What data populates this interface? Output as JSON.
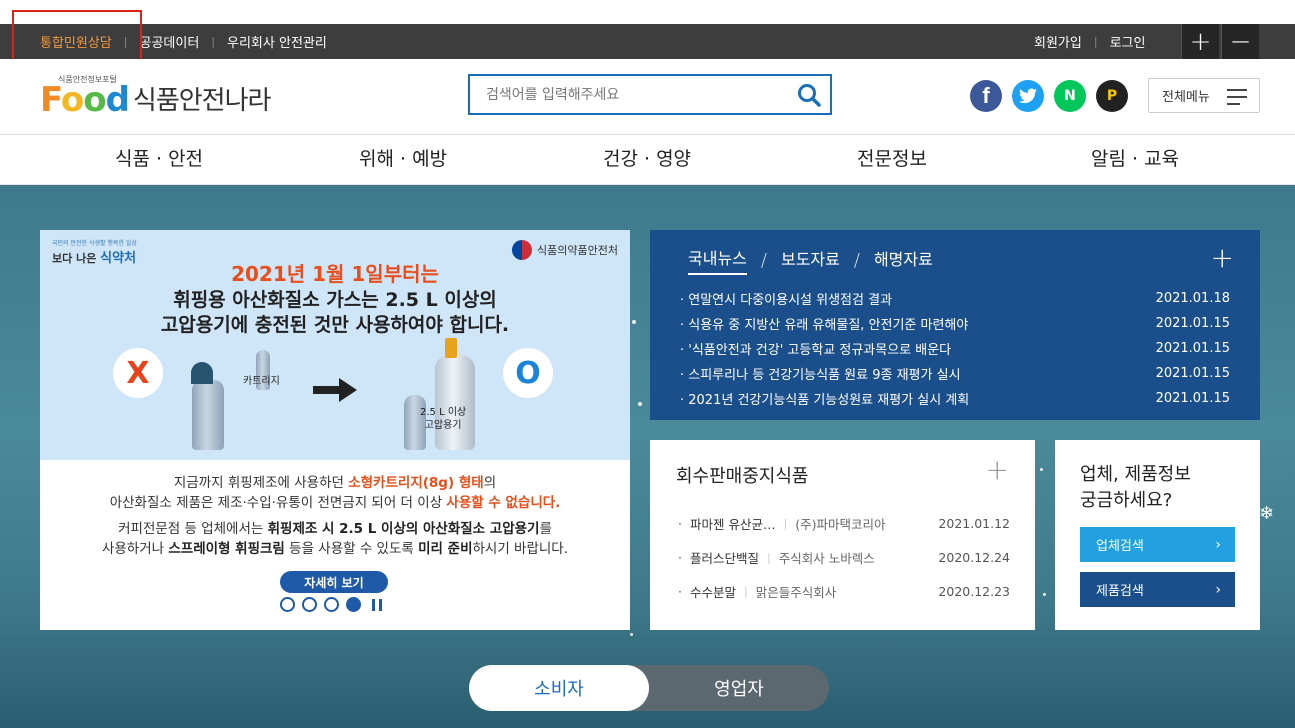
{
  "topbar": {
    "links": [
      "통합민원상담",
      "공공데이터",
      "우리회사 안전관리"
    ],
    "join": "회원가입",
    "login": "로그인",
    "zoom_in": "+",
    "zoom_out": "−"
  },
  "header": {
    "logo_sub": "식품안전정보포털",
    "logo_food": [
      "F",
      "o",
      "o",
      "d"
    ],
    "logo_title": "식품안전나라",
    "search_placeholder": "검색어를 입력해주세요",
    "social": {
      "facebook": "f",
      "naver": "N",
      "kakao": "P"
    },
    "all_menu": "전체메뉴"
  },
  "gnb": [
    "식품 · 안전",
    "위해 · 예방",
    "건강 · 영양",
    "전문정보",
    "알림 · 교육"
  ],
  "banner": {
    "brand_small": "국민의 안전한 식생활 행복한 일상",
    "brand": "보다 나은",
    "brand_mfds": "식약처",
    "agency": "식품의약품안전처",
    "head1": "2021년 1월 1일부터는",
    "head2": "휘핑용 아산화질소 가스는 2.5 L 이상의",
    "head3": "고압용기에 충전된 것만 사용하여야 합니다.",
    "mark_x": "X",
    "mark_o": "O",
    "cartridge": "카트리지",
    "cylinder_line1": "2.5 L 이상",
    "cylinder_line2": "고압용기",
    "text1_a": "지금까지 휘핑제조에 사용하던 ",
    "text1_b": "소형카트리지(8g) 형태",
    "text1_c": "의",
    "text2_a": "아산화질소 제품은 제조·수입·유통이 전면금지 되어 더 이상 ",
    "text2_b": "사용할 수 없습니다.",
    "text3_a": "커피전문점 등 업체에서는 ",
    "text3_b": "휘핑제조 시 2.5 L 이상의 아산화질소 고압용기",
    "text3_c": "를",
    "text4_a": "사용하거나  ",
    "text4_b": "스프레이형 휘핑크림",
    "text4_c": " 등을 사용할 수 있도록 ",
    "text4_d": "미리 준비",
    "text4_e": "하시기 바랍니다.",
    "more": "자세히 보기",
    "slide_total": 4,
    "slide_current": 4
  },
  "news": {
    "tabs": [
      "국내뉴스",
      "보도자료",
      "해명자료"
    ],
    "items": [
      {
        "title": "연말연시 다중이용시설 위생점검 결과",
        "date": "2021.01.18"
      },
      {
        "title": "식용유 중 지방산 유래 유해물질, 안전기준 마련해야",
        "date": "2021.01.15"
      },
      {
        "title": "'식품안전과 건강' 고등학교 정규과목으로 배운다",
        "date": "2021.01.15"
      },
      {
        "title": "스피루리나 등 건강기능식품 원료 9종 재평가 실시",
        "date": "2021.01.15"
      },
      {
        "title": "2021년 건강기능식품 기능성원료 재평가 실시 계획",
        "date": "2021.01.15"
      }
    ]
  },
  "recall": {
    "title": "회수판매중지식품",
    "items": [
      {
        "name": "파마젠 유산균…",
        "company": "(주)파마택코리아",
        "date": "2021.01.12"
      },
      {
        "name": "플러스단백질",
        "company": "주식회사 노바렉스",
        "date": "2020.12.24"
      },
      {
        "name": "수수분말",
        "company": "맑은들주식회사",
        "date": "2020.12.23"
      }
    ]
  },
  "biz": {
    "title_line1": "업체, 제품정보",
    "title_line2": "궁금하세요?",
    "btn_company": "업체검색",
    "btn_product": "제품검색"
  },
  "toggle": {
    "consumer": "소비자",
    "business": "영업자"
  },
  "colors": {
    "topbar": "#3d3d3d",
    "accent_orange": "#f39a3b",
    "news_bg": "#1b4f8b",
    "biz_blue": "#22a0e0",
    "highlight_red": "#d9241b"
  }
}
